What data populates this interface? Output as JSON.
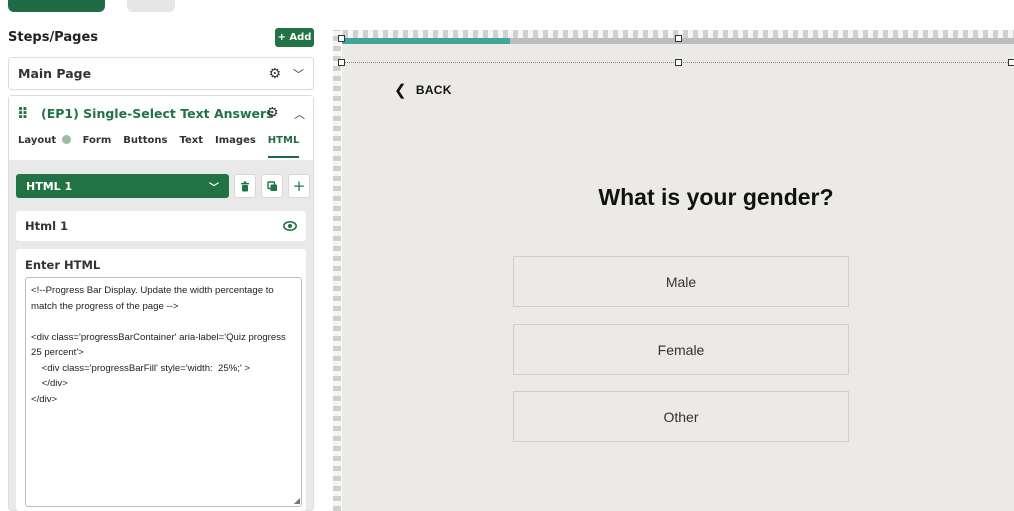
{
  "sidebar": {
    "title": "Steps/Pages",
    "add_label": "+ Add",
    "main_page": {
      "name": "Main Page"
    },
    "step": {
      "drag_glyph": "⠿",
      "name": "(EP1) Single-Select Text Answers",
      "tabs": [
        {
          "label": "Layout"
        },
        {
          "label": "Form"
        },
        {
          "label": "Buttons"
        },
        {
          "label": "Text"
        },
        {
          "label": "Images"
        },
        {
          "label": "HTML",
          "active": true
        }
      ],
      "html_select": {
        "value": "HTML 1"
      },
      "html_block": {
        "name": "Html 1"
      },
      "enter_html": {
        "label": "Enter HTML",
        "code": "<!--Progress Bar Display. Update the width percentage to match the progress of the page -->\n\n<div class='progressBarContainer' aria-label='Quiz progress 25 percent'>\n    <div class='progressBarFill' style='width:  25%;' >\n    </div>\n</div>"
      }
    }
  },
  "icons": {
    "gear": "gear-icon",
    "chevron_down": "chevron-down-icon",
    "chevron_up": "chevron-up-icon",
    "trash": "trash-icon",
    "copy": "copy-icon",
    "plus": "plus-icon",
    "eye": "eye-icon",
    "back": "chevron-left-icon"
  },
  "preview": {
    "progress_fraction": 0.25,
    "back_label": "BACK",
    "question": "What is your gender?",
    "answers": [
      "Male",
      "Female",
      "Other"
    ]
  },
  "colors": {
    "brand_green": "#217346",
    "progress_fill": "#43a597",
    "progress_track": "#bdbdbd",
    "canvas_bg": "#eceae6"
  }
}
